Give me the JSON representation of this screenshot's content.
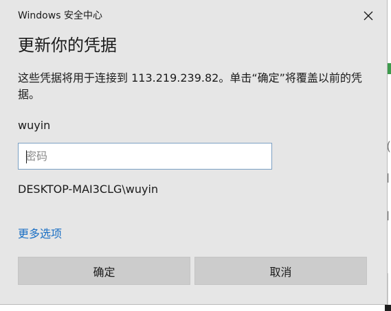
{
  "dialog": {
    "window_title": "Windows 安全中心",
    "heading": "更新你的凭据",
    "description": "这些凭据将用于连接到 113.219.239.82。单击“确定”将覆盖以前的凭据。",
    "username": "wuyin",
    "password": {
      "value": "",
      "placeholder": "密码"
    },
    "domain_user": "DESKTOP-MAI3CLG\\wuyin",
    "more_options": "更多选项",
    "ok_label": "确定",
    "cancel_label": "取消"
  },
  "colors": {
    "dialog_bg": "#e6e6e6",
    "link": "#1a6fc4",
    "button_bg": "#cccccc",
    "input_border": "#7a9fc2"
  },
  "icons": {
    "close": "close-icon"
  }
}
